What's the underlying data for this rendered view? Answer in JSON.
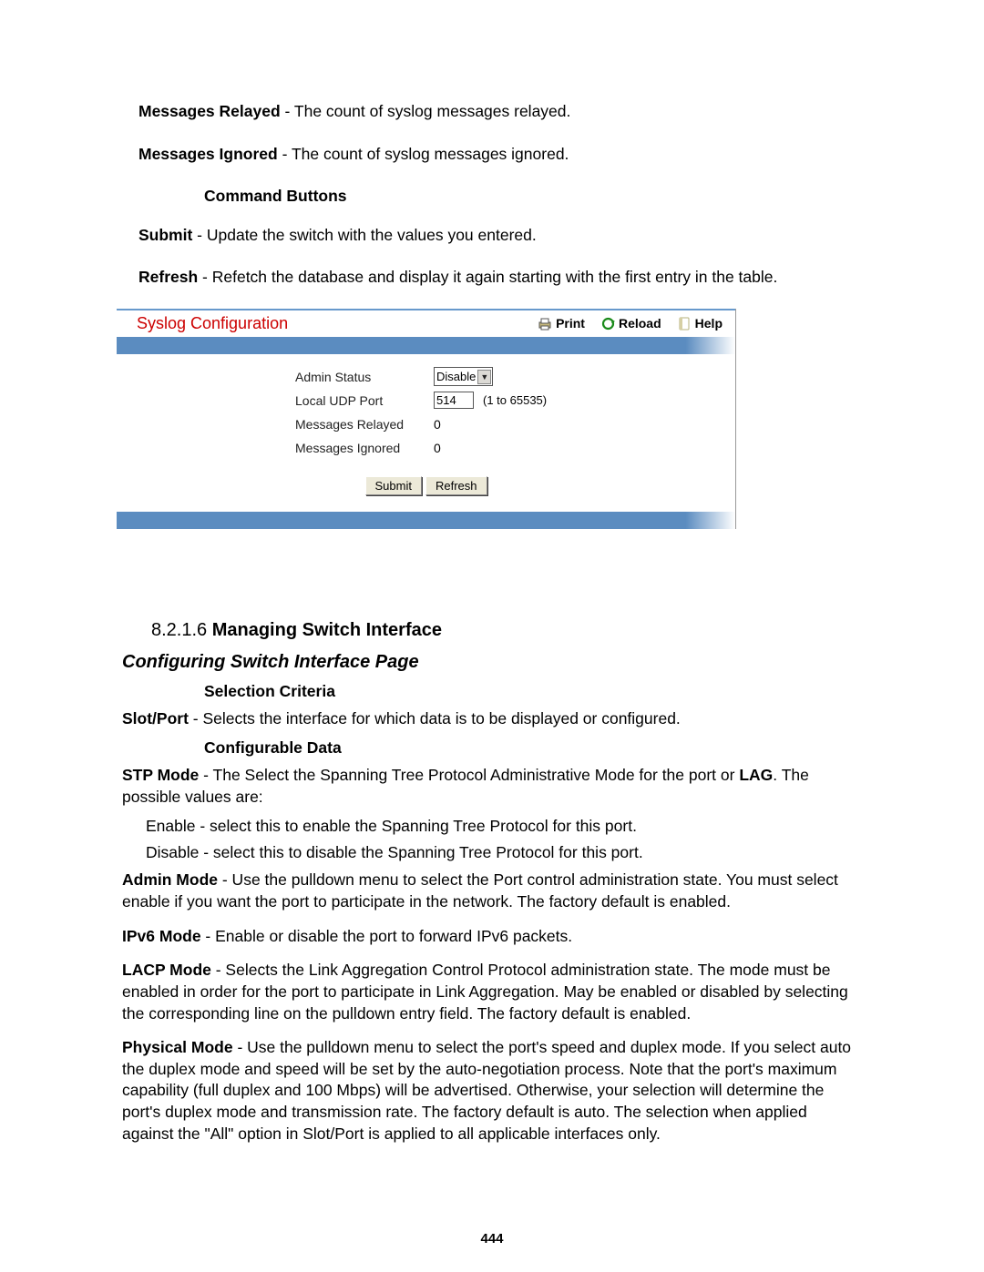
{
  "defs": {
    "msg_relayed_term": "Messages Relayed",
    "msg_relayed_desc": " - The count of syslog messages relayed.",
    "msg_ignored_term": "Messages Ignored",
    "msg_ignored_desc": " - The count of syslog messages ignored.",
    "cmd_buttons_title": "Command Buttons",
    "submit_term": "Submit",
    "submit_desc": " - Update the switch with the values you entered.",
    "refresh_term": "Refresh",
    "refresh_desc": " - Refetch the database and display it again starting with the first entry in the table."
  },
  "screenshot": {
    "title": "Syslog Configuration",
    "tools": {
      "print": "Print",
      "reload": "Reload",
      "help": "Help"
    },
    "rows": {
      "admin_status": {
        "label": "Admin Status",
        "value": "Disable"
      },
      "udp": {
        "label": "Local UDP Port",
        "value": "514",
        "range": "(1 to 65535)"
      },
      "relayed": {
        "label": "Messages Relayed",
        "value": "0"
      },
      "ignored": {
        "label": "Messages Ignored",
        "value": "0"
      }
    },
    "buttons": {
      "submit": "Submit",
      "refresh": "Refresh"
    }
  },
  "section": {
    "number": "8.2.1.6 ",
    "title": "Managing Switch Interface",
    "subhead": "Configuring Switch Interface Page",
    "selection_title": "Selection Criteria",
    "slot_port_term": "Slot/Port",
    "slot_port_desc": " - Selects the interface for which data is to be displayed or configured.",
    "config_title": "Configurable Data",
    "stp_term": "STP Mode",
    "stp_mid": " - The Select the Spanning Tree Protocol Administrative Mode for the port or ",
    "stp_lag": "LAG",
    "stp_tail": ". The possible values are:",
    "stp_enable": "Enable - select this to enable the Spanning Tree Protocol for this port.",
    "stp_disable": "Disable - select this to disable the Spanning Tree Protocol for this port.",
    "admin_term": "Admin Mode",
    "admin_desc": " - Use the pulldown menu to select the Port control administration state. You must select enable if you want the port to participate in the network. The factory default is enabled.",
    "ipv6_term": "IPv6 Mode",
    "ipv6_desc": " - Enable or disable the port to forward IPv6 packets.",
    "lacp_term": "LACP Mode",
    "lacp_desc": " - Selects the Link Aggregation Control Protocol administration state. The mode must be enabled in order for the port to participate in Link Aggregation. May be enabled or disabled by selecting the corresponding line on the pulldown entry field. The factory default is enabled.",
    "phys_term": "Physical Mode",
    "phys_desc": " - Use the pulldown menu to select the port's speed and duplex mode. If you select auto the duplex mode and speed will be set by the auto-negotiation process. Note that the port's maximum capability (full duplex and 100 Mbps) will be advertised. Otherwise, your selection will determine the port's duplex mode and transmission rate. The factory default is auto. The selection when applied against the \"All\" option in Slot/Port is applied to all applicable interfaces only."
  },
  "page_number": "444"
}
